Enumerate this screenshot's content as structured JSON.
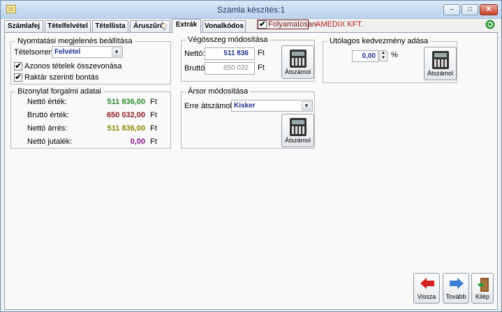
{
  "window": {
    "title": "Számla készítés:1",
    "minimize": "–",
    "maximize": "□",
    "close": "✕"
  },
  "tabs": [
    {
      "label": "Számlafej"
    },
    {
      "label": "Tételfelvétel"
    },
    {
      "label": "Tétellista"
    },
    {
      "label": "Áruszűrő"
    },
    {
      "label": "Extrák"
    },
    {
      "label": "Vonalkódos"
    }
  ],
  "folyamatosan": {
    "label": "Folyamatosan",
    "checked": "✔"
  },
  "company": "AMEDIX KFT.",
  "print_settings": {
    "title": "Nyomtatási megjelenés beállítása",
    "order_label": "Tételsorrend:",
    "order_value": "Felvétel",
    "merge_label": "Azonos tételek összevonása",
    "merge_checked": "✔",
    "split_label": "Raktár szerinti bontás",
    "split_checked": "✔"
  },
  "document_data": {
    "title": "Bizonylat forgalmi adatai",
    "rows": [
      {
        "label": "Nettó érték:",
        "value": "511 836,00",
        "unit": "Ft",
        "color": "#2a8a2a"
      },
      {
        "label": "Bruttó érték:",
        "value": "650 032,00",
        "unit": "Ft",
        "color": "#8b1a1a"
      },
      {
        "label": "Nettó árrés:",
        "value": "511 836,00",
        "unit": "Ft",
        "color": "#8a8a00"
      },
      {
        "label": "Nettó jutalék:",
        "value": "0,00",
        "unit": "Ft",
        "color": "#8a1a8a"
      }
    ]
  },
  "total_modify": {
    "title": "Végösszeg módosítása",
    "net_label": "Nettó:",
    "net_value": "511 836",
    "gross_label": "Bruttó:",
    "gross_value": "650 032",
    "unit": "Ft",
    "button": "Átszámol"
  },
  "price_modify": {
    "title": "Ársor módosítása",
    "label": "Erre átszámol:",
    "value": "Kisker",
    "button": "Átszámol"
  },
  "discount": {
    "title": "Utólagos kedvezmény adása",
    "value": "0,00",
    "unit": "%",
    "button": "Átszámol"
  },
  "nav": {
    "back": "Vissza",
    "next": "Tovább",
    "exit": "Kilép"
  },
  "icons": {
    "dropdown": "▼",
    "spin_up": "▲",
    "spin_down": "▼"
  }
}
